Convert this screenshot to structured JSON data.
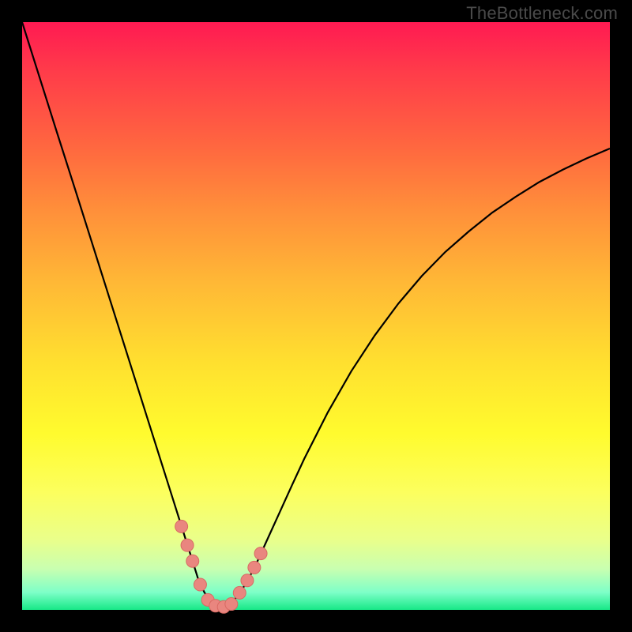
{
  "watermark": "TheBottleneck.com",
  "colors": {
    "frame": "#000000",
    "curve": "#000000",
    "marker_fill": "#e9867f",
    "marker_stroke": "#d86a63"
  },
  "chart_data": {
    "type": "line",
    "title": "",
    "xlabel": "",
    "ylabel": "",
    "xlim": [
      0,
      1
    ],
    "ylim": [
      0,
      1
    ],
    "x": [
      0.0,
      0.03,
      0.06,
      0.09,
      0.12,
      0.15,
      0.18,
      0.21,
      0.24,
      0.27,
      0.29,
      0.3,
      0.31,
      0.32,
      0.325,
      0.33,
      0.335,
      0.34,
      0.345,
      0.35,
      0.36,
      0.37,
      0.38,
      0.39,
      0.4,
      0.42,
      0.44,
      0.46,
      0.48,
      0.52,
      0.56,
      0.6,
      0.64,
      0.68,
      0.72,
      0.76,
      0.8,
      0.84,
      0.88,
      0.92,
      0.96,
      1.0
    ],
    "values": [
      1.0,
      0.905,
      0.81,
      0.716,
      0.621,
      0.526,
      0.431,
      0.336,
      0.241,
      0.146,
      0.083,
      0.051,
      0.03,
      0.015,
      0.01,
      0.007,
      0.005,
      0.005,
      0.006,
      0.008,
      0.016,
      0.028,
      0.044,
      0.062,
      0.082,
      0.126,
      0.17,
      0.214,
      0.257,
      0.336,
      0.406,
      0.467,
      0.521,
      0.568,
      0.609,
      0.644,
      0.676,
      0.703,
      0.728,
      0.749,
      0.768,
      0.785
    ],
    "markers": {
      "x": [
        0.271,
        0.281,
        0.29,
        0.303,
        0.316,
        0.329,
        0.343,
        0.356,
        0.37,
        0.383,
        0.395,
        0.406
      ],
      "y": [
        0.142,
        0.11,
        0.083,
        0.043,
        0.017,
        0.007,
        0.005,
        0.01,
        0.029,
        0.05,
        0.072,
        0.096
      ]
    }
  }
}
